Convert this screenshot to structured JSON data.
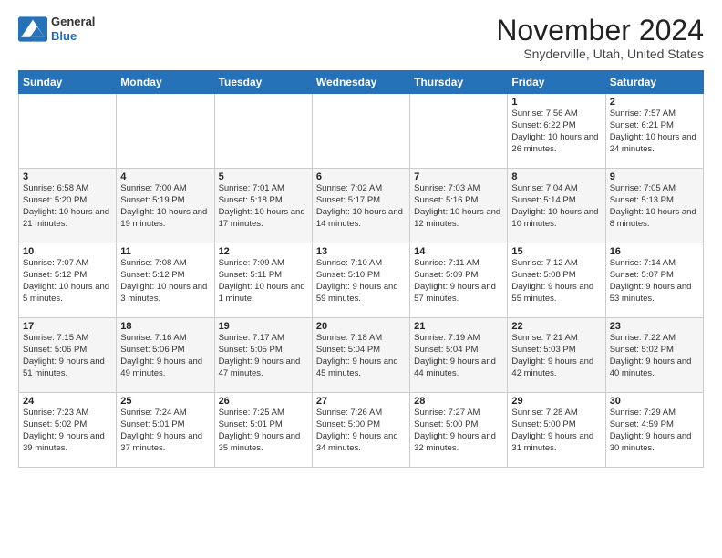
{
  "logo": {
    "line1": "General",
    "line2": "Blue"
  },
  "header": {
    "title": "November 2024",
    "location": "Snyderville, Utah, United States"
  },
  "weekdays": [
    "Sunday",
    "Monday",
    "Tuesday",
    "Wednesday",
    "Thursday",
    "Friday",
    "Saturday"
  ],
  "weeks": [
    [
      {
        "day": "",
        "info": ""
      },
      {
        "day": "",
        "info": ""
      },
      {
        "day": "",
        "info": ""
      },
      {
        "day": "",
        "info": ""
      },
      {
        "day": "",
        "info": ""
      },
      {
        "day": "1",
        "info": "Sunrise: 7:56 AM\nSunset: 6:22 PM\nDaylight: 10 hours\nand 26 minutes."
      },
      {
        "day": "2",
        "info": "Sunrise: 7:57 AM\nSunset: 6:21 PM\nDaylight: 10 hours\nand 24 minutes."
      }
    ],
    [
      {
        "day": "3",
        "info": "Sunrise: 6:58 AM\nSunset: 5:20 PM\nDaylight: 10 hours\nand 21 minutes."
      },
      {
        "day": "4",
        "info": "Sunrise: 7:00 AM\nSunset: 5:19 PM\nDaylight: 10 hours\nand 19 minutes."
      },
      {
        "day": "5",
        "info": "Sunrise: 7:01 AM\nSunset: 5:18 PM\nDaylight: 10 hours\nand 17 minutes."
      },
      {
        "day": "6",
        "info": "Sunrise: 7:02 AM\nSunset: 5:17 PM\nDaylight: 10 hours\nand 14 minutes."
      },
      {
        "day": "7",
        "info": "Sunrise: 7:03 AM\nSunset: 5:16 PM\nDaylight: 10 hours\nand 12 minutes."
      },
      {
        "day": "8",
        "info": "Sunrise: 7:04 AM\nSunset: 5:14 PM\nDaylight: 10 hours\nand 10 minutes."
      },
      {
        "day": "9",
        "info": "Sunrise: 7:05 AM\nSunset: 5:13 PM\nDaylight: 10 hours\nand 8 minutes."
      }
    ],
    [
      {
        "day": "10",
        "info": "Sunrise: 7:07 AM\nSunset: 5:12 PM\nDaylight: 10 hours\nand 5 minutes."
      },
      {
        "day": "11",
        "info": "Sunrise: 7:08 AM\nSunset: 5:12 PM\nDaylight: 10 hours\nand 3 minutes."
      },
      {
        "day": "12",
        "info": "Sunrise: 7:09 AM\nSunset: 5:11 PM\nDaylight: 10 hours\nand 1 minute."
      },
      {
        "day": "13",
        "info": "Sunrise: 7:10 AM\nSunset: 5:10 PM\nDaylight: 9 hours\nand 59 minutes."
      },
      {
        "day": "14",
        "info": "Sunrise: 7:11 AM\nSunset: 5:09 PM\nDaylight: 9 hours\nand 57 minutes."
      },
      {
        "day": "15",
        "info": "Sunrise: 7:12 AM\nSunset: 5:08 PM\nDaylight: 9 hours\nand 55 minutes."
      },
      {
        "day": "16",
        "info": "Sunrise: 7:14 AM\nSunset: 5:07 PM\nDaylight: 9 hours\nand 53 minutes."
      }
    ],
    [
      {
        "day": "17",
        "info": "Sunrise: 7:15 AM\nSunset: 5:06 PM\nDaylight: 9 hours\nand 51 minutes."
      },
      {
        "day": "18",
        "info": "Sunrise: 7:16 AM\nSunset: 5:06 PM\nDaylight: 9 hours\nand 49 minutes."
      },
      {
        "day": "19",
        "info": "Sunrise: 7:17 AM\nSunset: 5:05 PM\nDaylight: 9 hours\nand 47 minutes."
      },
      {
        "day": "20",
        "info": "Sunrise: 7:18 AM\nSunset: 5:04 PM\nDaylight: 9 hours\nand 45 minutes."
      },
      {
        "day": "21",
        "info": "Sunrise: 7:19 AM\nSunset: 5:04 PM\nDaylight: 9 hours\nand 44 minutes."
      },
      {
        "day": "22",
        "info": "Sunrise: 7:21 AM\nSunset: 5:03 PM\nDaylight: 9 hours\nand 42 minutes."
      },
      {
        "day": "23",
        "info": "Sunrise: 7:22 AM\nSunset: 5:02 PM\nDaylight: 9 hours\nand 40 minutes."
      }
    ],
    [
      {
        "day": "24",
        "info": "Sunrise: 7:23 AM\nSunset: 5:02 PM\nDaylight: 9 hours\nand 39 minutes."
      },
      {
        "day": "25",
        "info": "Sunrise: 7:24 AM\nSunset: 5:01 PM\nDaylight: 9 hours\nand 37 minutes."
      },
      {
        "day": "26",
        "info": "Sunrise: 7:25 AM\nSunset: 5:01 PM\nDaylight: 9 hours\nand 35 minutes."
      },
      {
        "day": "27",
        "info": "Sunrise: 7:26 AM\nSunset: 5:00 PM\nDaylight: 9 hours\nand 34 minutes."
      },
      {
        "day": "28",
        "info": "Sunrise: 7:27 AM\nSunset: 5:00 PM\nDaylight: 9 hours\nand 32 minutes."
      },
      {
        "day": "29",
        "info": "Sunrise: 7:28 AM\nSunset: 5:00 PM\nDaylight: 9 hours\nand 31 minutes."
      },
      {
        "day": "30",
        "info": "Sunrise: 7:29 AM\nSunset: 4:59 PM\nDaylight: 9 hours\nand 30 minutes."
      }
    ]
  ]
}
